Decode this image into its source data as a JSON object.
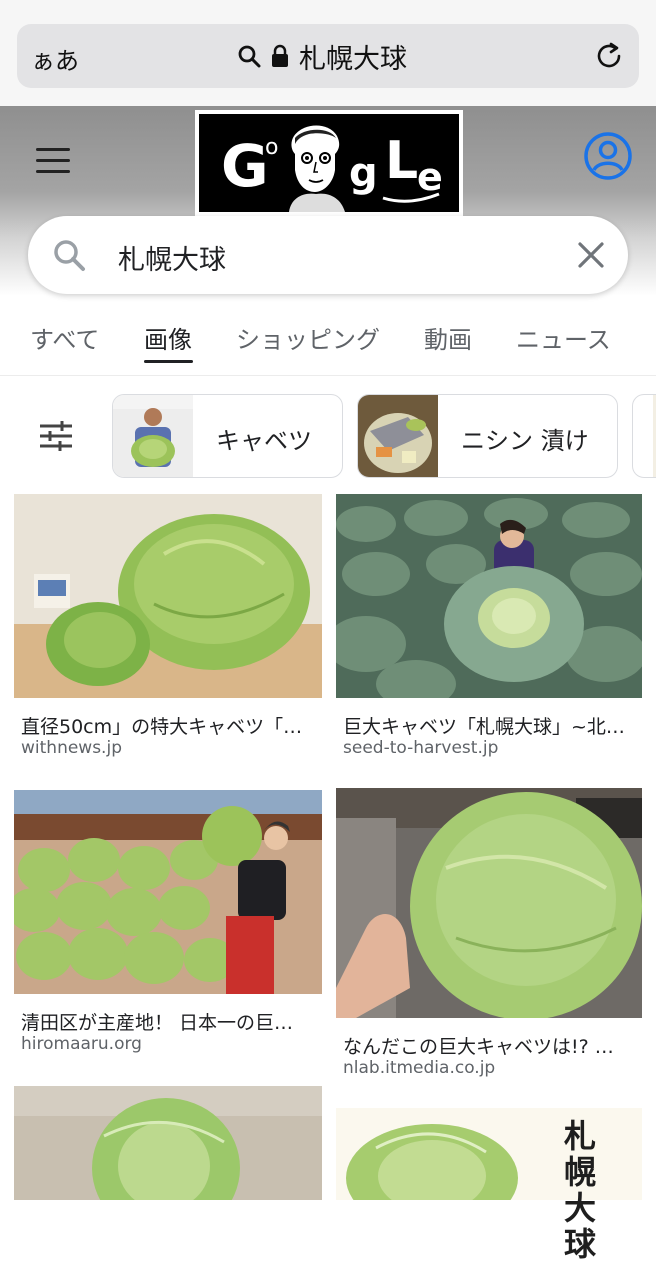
{
  "safari": {
    "aa_label": "ぁあ",
    "url_text": "札幌大球"
  },
  "search": {
    "query": "札幌大球"
  },
  "doodle": {
    "letters": [
      "G",
      "o",
      "g",
      "L",
      "e"
    ]
  },
  "tabs": [
    {
      "label": "すべて",
      "active": false
    },
    {
      "label": "画像",
      "active": true
    },
    {
      "label": "ショッピング",
      "active": false
    },
    {
      "label": "動画",
      "active": false
    },
    {
      "label": "ニュース",
      "active": false
    }
  ],
  "chips": [
    {
      "label": "キャベツ"
    },
    {
      "label": "ニシン 漬け"
    }
  ],
  "results": [
    {
      "title": "直径50cm」の特大キャベツ「…",
      "source": "withnews.jp"
    },
    {
      "title": "巨大キャベツ「札幌大球」~北…",
      "source": "seed-to-harvest.jp"
    },
    {
      "title": "清田区が主産地！ 日本一の巨…",
      "source": "hiromaaru.org"
    },
    {
      "title": "なんだこの巨大キャベツは!? …",
      "source": "nlab.itmedia.co.jp"
    }
  ],
  "partial_image_text": "札幌大球",
  "colors": {
    "accent_blue": "#1a73e8",
    "cabbage_green": "#9cc35a"
  }
}
